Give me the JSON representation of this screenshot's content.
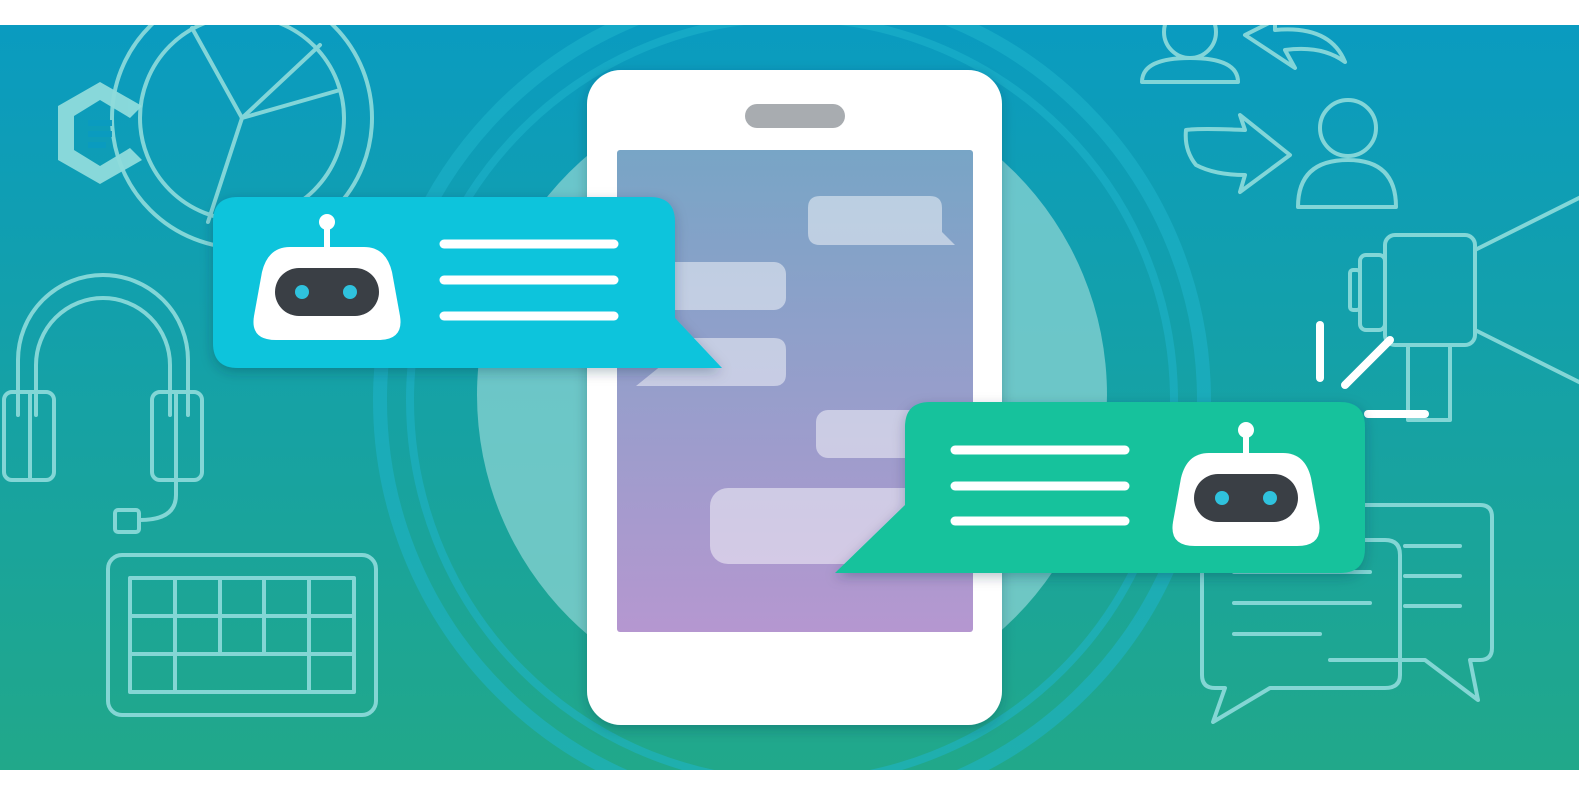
{
  "illustration": {
    "subject": "chatbot-conversation",
    "palette": {
      "background_top": "#0a9bc0",
      "background_bottom": "#21a88a",
      "outline": "#8fdcdc",
      "phone_body": "#ffffff",
      "phone_screen_top": "#78a5c6",
      "phone_screen_bottom": "#b597d0",
      "chat_bubble_left": "#0ac4dc",
      "chat_bubble_right": "#12c29c",
      "robot_face": "#ffffff",
      "robot_visor": "#3a3f45",
      "robot_eye": "#2fc2dd"
    },
    "icons": [
      "brand-logo-icon",
      "pie-chart-icon",
      "headset-icon",
      "keyboard-icon",
      "users-exchange-icon",
      "megaphone-icon",
      "chat-bubbles-icon",
      "robot-icon",
      "smartphone-icon"
    ]
  }
}
